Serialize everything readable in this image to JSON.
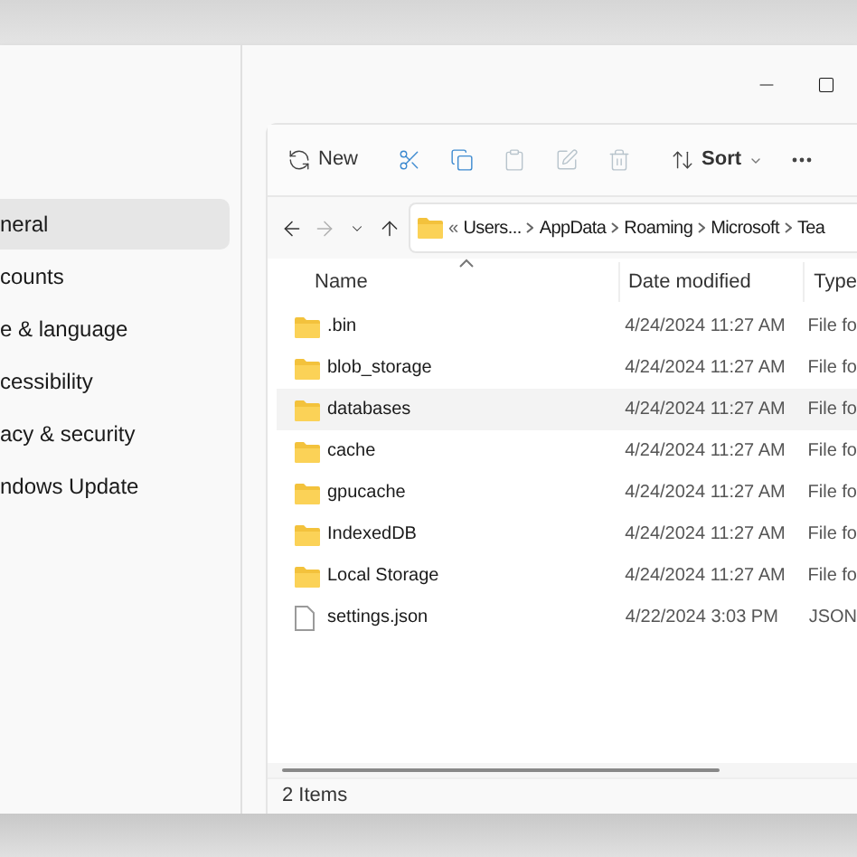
{
  "settings_sidebar": {
    "items": [
      {
        "label": "neral",
        "selected": true
      },
      {
        "label": "counts",
        "selected": false
      },
      {
        "label": "e & language",
        "selected": false
      },
      {
        "label": "cessibility",
        "selected": false
      },
      {
        "label": "acy & security",
        "selected": false
      },
      {
        "label": "ndows Update",
        "selected": false
      }
    ]
  },
  "explorer": {
    "toolbar": [
      {
        "kind": "new",
        "label": "New",
        "disabled": false
      },
      {
        "kind": "cut",
        "disabled": false
      },
      {
        "kind": "copy",
        "disabled": false
      },
      {
        "kind": "paste",
        "disabled": true
      },
      {
        "kind": "rename",
        "disabled": true
      },
      {
        "kind": "delete",
        "disabled": true
      },
      {
        "kind": "sort",
        "label": "Sort",
        "disabled": false
      },
      {
        "kind": "more",
        "disabled": false
      }
    ],
    "nav": [
      {
        "kind": "back",
        "disabled": false
      },
      {
        "kind": "forward",
        "disabled": true
      },
      {
        "kind": "recent",
        "disabled": false
      },
      {
        "kind": "up",
        "disabled": false
      }
    ],
    "breadcrumb": [
      "«",
      "Users...",
      "AppData",
      "Roaming",
      "Microsoft",
      "Tea"
    ],
    "columns": [
      "Name",
      "Date modified",
      "Type"
    ],
    "rows": [
      {
        "kind": "folder",
        "name": ".bin",
        "date": "4/24/2024 11:27 AM",
        "type": "File fo",
        "selected": false
      },
      {
        "kind": "folder",
        "name": "blob_storage",
        "date": "4/24/2024 11:27 AM",
        "type": "File fo",
        "selected": false
      },
      {
        "kind": "folder",
        "name": "databases",
        "date": "4/24/2024 11:27 AM",
        "type": "File fo",
        "selected": true
      },
      {
        "kind": "folder",
        "name": "cache",
        "date": "4/24/2024 11:27 AM",
        "type": "File fo",
        "selected": false
      },
      {
        "kind": "folder",
        "name": "gpucache",
        "date": "4/24/2024 11:27 AM",
        "type": "File fo",
        "selected": false
      },
      {
        "kind": "folder",
        "name": "IndexedDB",
        "date": "4/24/2024 11:27 AM",
        "type": "File fo",
        "selected": false
      },
      {
        "kind": "folder",
        "name": "Local Storage",
        "date": "4/24/2024 11:27 AM",
        "type": "File fo",
        "selected": false
      },
      {
        "kind": "file",
        "name": "settings.json",
        "date": "4/22/2024 3:03 PM",
        "type": "JSON",
        "selected": false
      }
    ],
    "status_bar": {
      "item_count": "2 Items"
    }
  }
}
